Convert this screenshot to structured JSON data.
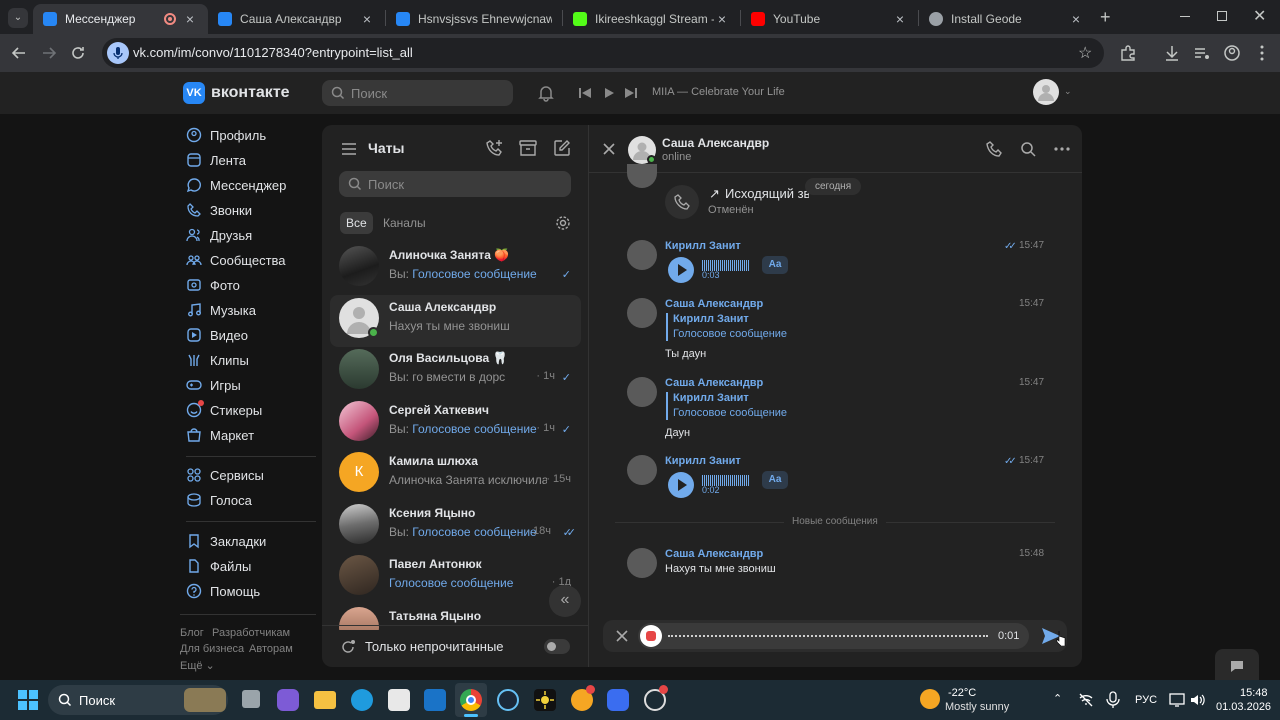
{
  "browser": {
    "tabs": [
      {
        "title": "Мессенджер",
        "active": true,
        "favicon_color": "#2787f5",
        "recording": true
      },
      {
        "title": "Саша Александвр",
        "favicon_color": "#2787f5"
      },
      {
        "title": "Hsnvsjssvs Ehnevwjcnawgv",
        "favicon_color": "#2787f5"
      },
      {
        "title": "Ikireeshkaggl Stream - Wat",
        "favicon_color": "#53fc18"
      },
      {
        "title": "YouTube",
        "favicon_color": "#ff0000"
      },
      {
        "title": "Install Geode",
        "favicon_color": "#9aa0a6"
      }
    ],
    "url": "vk.com/im/convo/1101278340?entrypoint=list_all"
  },
  "vk": {
    "logo_text": "вконтакте",
    "search_placeholder": "Поиск",
    "player_track": "MIIA — Celebrate Your Life",
    "accent": "#71aaeb"
  },
  "menu": {
    "items": [
      {
        "label": "Профиль",
        "icon": "profile-icon"
      },
      {
        "label": "Лента",
        "icon": "feed-icon"
      },
      {
        "label": "Мессенджер",
        "icon": "messenger-icon"
      },
      {
        "label": "Звонки",
        "icon": "phone-icon"
      },
      {
        "label": "Друзья",
        "icon": "friends-icon"
      },
      {
        "label": "Сообщества",
        "icon": "communities-icon"
      },
      {
        "label": "Фото",
        "icon": "photo-icon"
      },
      {
        "label": "Музыка",
        "icon": "music-icon"
      },
      {
        "label": "Видео",
        "icon": "video-icon"
      },
      {
        "label": "Клипы",
        "icon": "clips-icon"
      },
      {
        "label": "Игры",
        "icon": "games-icon"
      },
      {
        "label": "Стикеры",
        "icon": "stickers-icon"
      },
      {
        "label": "Маркет",
        "icon": "market-icon"
      }
    ],
    "items2": [
      {
        "label": "Сервисы",
        "icon": "services-icon"
      },
      {
        "label": "Голоса",
        "icon": "votes-icon"
      }
    ],
    "items3": [
      {
        "label": "Закладки",
        "icon": "bookmarks-icon"
      },
      {
        "label": "Файлы",
        "icon": "files-icon"
      },
      {
        "label": "Помощь",
        "icon": "help-icon"
      }
    ],
    "footer": {
      "blog": "Блог",
      "developers": "Разработчикам",
      "business": "Для бизнеса",
      "authors": "Авторам",
      "more": "Ещё ⌄"
    }
  },
  "chats": {
    "title": "Чаты",
    "search_placeholder": "Поиск",
    "filter_all": "Все",
    "filter_channels": "Каналы",
    "unread_only": "Только непрочитанные",
    "list": [
      {
        "name": "Алиночка Занята 🍑",
        "prefix": "Вы: ",
        "message": "Голосовое сообщение",
        "highlight": true,
        "time": "",
        "check": "✓"
      },
      {
        "name": "Саша Александвр",
        "prefix": "",
        "message": "Нахуя ты мне звониш",
        "highlight": false,
        "time": "",
        "check": ""
      },
      {
        "name": "Оля Васильцова 🦷",
        "prefix": "Вы: ",
        "message": "го вмести в дорс",
        "highlight": false,
        "time": "· 1ч",
        "check": "✓"
      },
      {
        "name": "Сергей Хаткевич",
        "prefix": "Вы: ",
        "message": "Голосовое сообщение",
        "highlight": true,
        "time": "· 1ч",
        "check": "✓"
      },
      {
        "name": "Камила шлюха",
        "prefix": "",
        "message": "Алиночка Занята исключила ...",
        "highlight": false,
        "time": "· 15ч",
        "check": ""
      },
      {
        "name": "Ксения Яцыно",
        "prefix": "Вы: ",
        "message": "Голосовое сообщение",
        "highlight": true,
        "time": "· 18ч",
        "check": "✓✓"
      },
      {
        "name": "Павел Антонюк",
        "prefix": "",
        "message": "Голосовое сообщение",
        "highlight": true,
        "time": "· 1д",
        "check": ""
      },
      {
        "name": "Татьяна Яцыно",
        "prefix": "",
        "message": "",
        "highlight": false,
        "time": "",
        "check": ""
      }
    ],
    "kamila_initial": "К"
  },
  "conversation": {
    "name": "Саша Александвр",
    "status": "online",
    "date_chip": "сегодня",
    "call": {
      "title": "Исходящий звонок",
      "status": "Отменён"
    },
    "messages": [
      {
        "author": "Кирилл Занит",
        "time": "15:47",
        "voice_duration": "0:03",
        "transcribe": "Aa"
      },
      {
        "author": "Саша Александвр",
        "time": "15:47",
        "reply_author": "Кирилл Занит",
        "reply_text": "Голосовое сообщение",
        "text": "Ты даун"
      },
      {
        "author": "Саша Александвр",
        "time": "15:47",
        "reply_author": "Кирилл Занит",
        "reply_text": "Голосовое сообщение",
        "text": "Даун"
      },
      {
        "author": "Кирилл Занит",
        "time": "15:47",
        "voice_duration": "0:02",
        "transcribe": "Aa"
      },
      {
        "author": "Саша Александвр",
        "time": "15:48",
        "text": "Нахуя ты мне звониш"
      }
    ],
    "new_messages_divider": "Новые сообщения",
    "recording_time": "0:01"
  },
  "taskbar": {
    "search": "Поиск",
    "weather_temp": "-22°C",
    "weather_desc": "Mostly sunny",
    "lang": "РУС",
    "time": "15:48",
    "date": "01.03.2026"
  }
}
